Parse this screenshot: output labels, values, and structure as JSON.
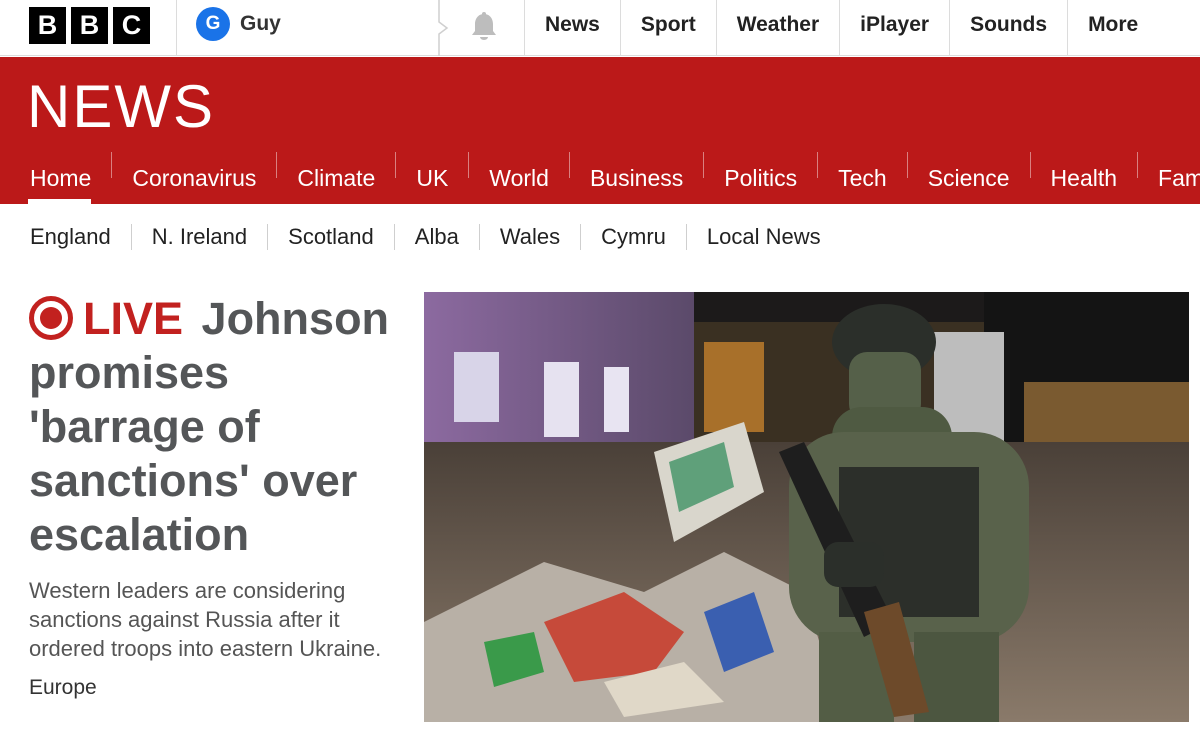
{
  "brand": {
    "logo_letters": [
      "B",
      "B",
      "C"
    ]
  },
  "account": {
    "initial": "G",
    "name": "Guy"
  },
  "icons": {
    "notifications": "bell-icon",
    "live": "live-record-icon"
  },
  "top_nav": [
    "News",
    "Sport",
    "Weather",
    "iPlayer",
    "Sounds",
    "More"
  ],
  "banner": {
    "title": "NEWS",
    "background": "#bb1919"
  },
  "main_nav": [
    "Home",
    "Coronavirus",
    "Climate",
    "UK",
    "World",
    "Business",
    "Politics",
    "Tech",
    "Science",
    "Health",
    "Fami"
  ],
  "main_nav_active": "Home",
  "sub_nav": [
    "England",
    "N. Ireland",
    "Scotland",
    "Alba",
    "Wales",
    "Cymru",
    "Local News"
  ],
  "story": {
    "live_label": "LIVE",
    "headline": "Johnson promises 'barrage of sanctions' over escalation",
    "summary": "Western leaders are considering sanctions against Russia after it ordered troops into eastern Ukraine.",
    "section": "Europe",
    "live_color": "#c2211f"
  }
}
